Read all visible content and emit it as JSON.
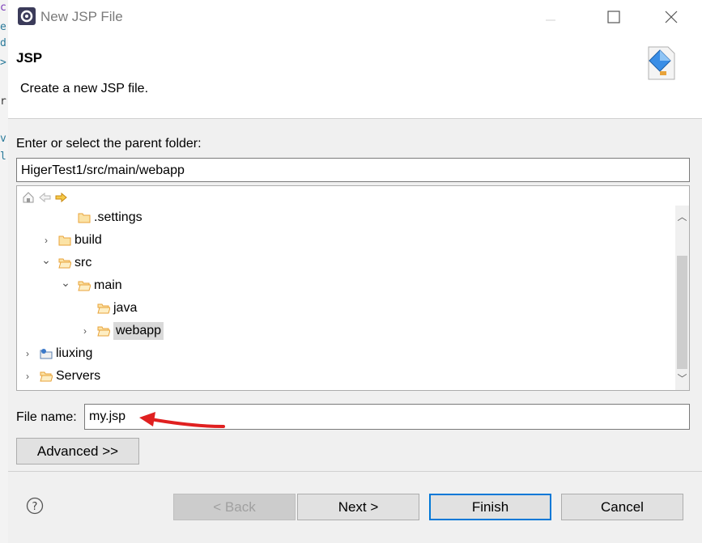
{
  "window": {
    "title": "New JSP File"
  },
  "header": {
    "title": "JSP",
    "description": "Create a new JSP file."
  },
  "folder": {
    "label": "Enter or select the parent folder:",
    "value": "HigerTest1/src/main/webapp"
  },
  "tree": {
    "items": [
      {
        "label": ".settings",
        "depth": 2,
        "chevron": "",
        "icon": "folder-icon"
      },
      {
        "label": "build",
        "depth": 1,
        "chevron": "›",
        "icon": "folder-icon"
      },
      {
        "label": "src",
        "depth": 1,
        "chevron": "⌄",
        "icon": "folder-open-icon"
      },
      {
        "label": "main",
        "depth": 2,
        "chevron": "⌄",
        "icon": "folder-open-icon"
      },
      {
        "label": "java",
        "depth": 3,
        "chevron": "",
        "icon": "folder-open-icon"
      },
      {
        "label": "webapp",
        "depth": 3,
        "chevron": "›",
        "icon": "folder-open-icon",
        "selected": true
      },
      {
        "label": "liuxing",
        "depth": 0,
        "chevron": "›",
        "icon": "project-icon"
      },
      {
        "label": "Servers",
        "depth": 0,
        "chevron": "›",
        "icon": "folder-open-icon"
      }
    ]
  },
  "file": {
    "label": "File name:",
    "value": "my.jsp"
  },
  "buttons": {
    "advanced": "Advanced >>",
    "back": "< Back",
    "next": "Next >",
    "finish": "Finish",
    "cancel": "Cancel"
  },
  "colors": {
    "accent": "#0078d7",
    "arrow": "#e02020",
    "folder": "#e8a33a"
  }
}
